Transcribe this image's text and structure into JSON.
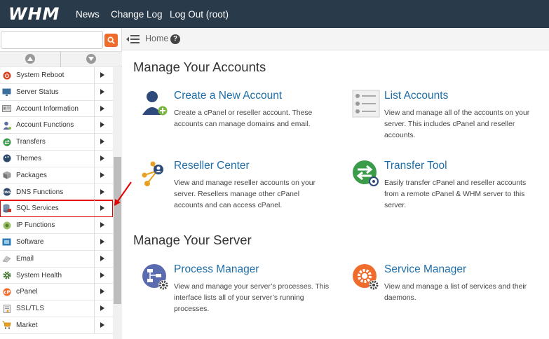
{
  "topbar": {
    "logo": "WHM",
    "nav": [
      "News",
      "Change Log",
      "Log Out (root)"
    ]
  },
  "sidebar": {
    "search_placeholder": "",
    "items": [
      {
        "label": "System Reboot",
        "icon": "power-icon",
        "color": "#d9411e"
      },
      {
        "label": "Server Status",
        "icon": "monitor-icon",
        "color": "#3a6e9c"
      },
      {
        "label": "Account Information",
        "icon": "id-card-icon",
        "color": "#888888"
      },
      {
        "label": "Account Functions",
        "icon": "user-icon",
        "color": "#5a6fa0"
      },
      {
        "label": "Transfers",
        "icon": "transfer-icon",
        "color": "#3a9b48"
      },
      {
        "label": "Themes",
        "icon": "palette-icon",
        "color": "#2d4a6b"
      },
      {
        "label": "Packages",
        "icon": "package-icon",
        "color": "#777777"
      },
      {
        "label": "DNS Functions",
        "icon": "dns-icon",
        "color": "#2d4a6b"
      },
      {
        "label": "SQL Services",
        "icon": "database-icon",
        "color": "#c0392b"
      },
      {
        "label": "IP Functions",
        "icon": "ip-icon",
        "color": "#6a9b3a"
      },
      {
        "label": "Software",
        "icon": "software-icon",
        "color": "#2e7bb5"
      },
      {
        "label": "Email",
        "icon": "email-icon",
        "color": "#999999"
      },
      {
        "label": "System Health",
        "icon": "gear-icon",
        "color": "#4a7b3a"
      },
      {
        "label": "cPanel",
        "icon": "cpanel-icon",
        "color": "#ef6c2c"
      },
      {
        "label": "SSL/TLS",
        "icon": "certificate-icon",
        "color": "#888888"
      },
      {
        "label": "Market",
        "icon": "cart-icon",
        "color": "#e8a020"
      }
    ],
    "highlighted": "SQL Services"
  },
  "breadcrumb": {
    "home": "Home",
    "help": "?"
  },
  "main": {
    "sections": [
      {
        "title": "Manage Your Accounts",
        "cards": [
          {
            "title": "Create a New Account",
            "desc": "Create a cPanel or reseller account. These accounts can manage domains and email.",
            "icon": "add-user-icon"
          },
          {
            "title": "List Accounts",
            "desc": "View and manage all of the accounts on your server. This includes cPanel and reseller accounts.",
            "icon": "list-icon"
          },
          {
            "title": "Reseller Center",
            "desc": "View and manage reseller accounts on your server. Resellers manage other cPanel accounts and can access cPanel.",
            "icon": "reseller-icon"
          },
          {
            "title": "Transfer Tool",
            "desc": "Easily transfer cPanel and reseller accounts from a remote cPanel & WHM server to this server.",
            "icon": "transfer-tool-icon"
          }
        ]
      },
      {
        "title": "Manage Your Server",
        "cards": [
          {
            "title": "Process Manager",
            "desc": "View and manage your server’s processes. This interface lists all of your server’s running processes.",
            "icon": "process-icon"
          },
          {
            "title": "Service Manager",
            "desc": "View and manage a list of services and their daemons.",
            "icon": "service-icon"
          }
        ]
      }
    ]
  },
  "colors": {
    "topbar": "#293a4a",
    "link": "#1e6ea8",
    "accent": "#ef6c2c",
    "highlight": "#e30000"
  }
}
